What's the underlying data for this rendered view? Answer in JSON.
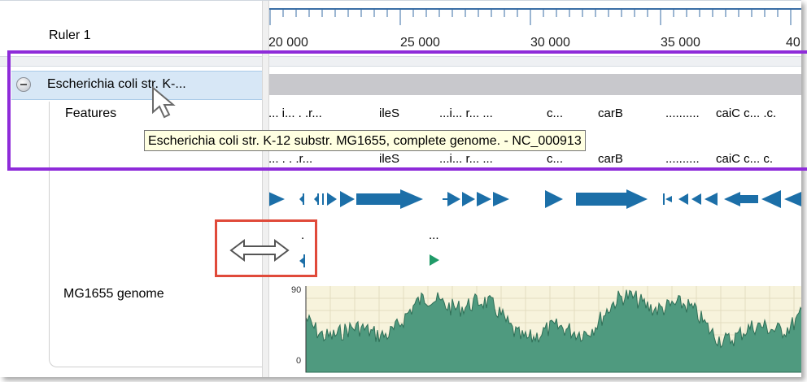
{
  "ruler": {
    "label": "Ruler 1",
    "ticks": [
      "20 000",
      "25 000",
      "30 000",
      "35 000",
      "40"
    ]
  },
  "sequence": {
    "title": "Escherichia coli str. K-...",
    "tooltip": "Escherichia coli str. K-12 substr. MG1655, complete genome.  - NC_000913"
  },
  "tracks": {
    "features_label": "Features",
    "genome_label": "MG1655 genome",
    "feature_annotations_row1": [
      "... i... . .r...",
      "ileS",
      "...i... r... ...",
      "c...",
      "carB",
      "..........",
      "caiC c... .c."
    ],
    "feature_annotations_row2": [
      "... . . .r...",
      "ileS",
      "...i... r... ...",
      "c...",
      "carB",
      "..........",
      "caiC c... c."
    ],
    "small_annotations": [
      ".",
      "..."
    ],
    "graph_ymax": "90",
    "graph_ymin": "0"
  },
  "colors": {
    "arrow_blue": "#1c6fa8",
    "arrow_green": "#1f9a68",
    "graph_fill": "#4f9a7f",
    "graph_bg": "#f7f3dc",
    "highlight_purple": "#8e2bd9",
    "highlight_red": "#e04a3a",
    "tooltip_bg": "#ffffe1"
  },
  "icons": {
    "collapse": "collapse-circle-icon",
    "cursor": "arrow-cursor-icon",
    "resize": "horizontal-resize-icon"
  }
}
